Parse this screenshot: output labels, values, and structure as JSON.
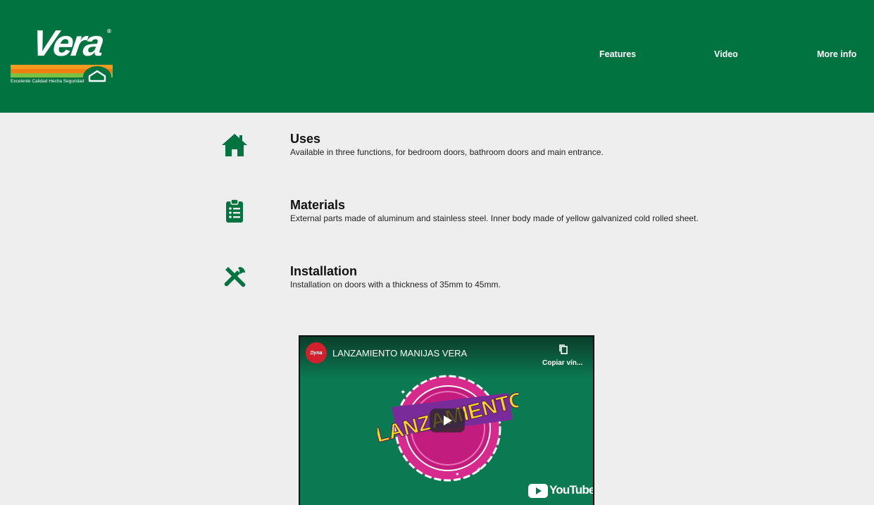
{
  "brand": {
    "name": "Vera",
    "registered": "®",
    "tagline": "Excelente Calidad Hecha Seguridad",
    "colors": {
      "primary": "#007340",
      "orange": "#f39a1e",
      "green_light": "#7cc242"
    }
  },
  "nav": {
    "items": [
      {
        "label": "Features"
      },
      {
        "label": "Video"
      },
      {
        "label": "More info"
      }
    ]
  },
  "features": [
    {
      "icon": "home-icon",
      "title": "Uses",
      "description": "Available in three functions, for bedroom doors, bathroom doors and main entrance."
    },
    {
      "icon": "clipboard-list-icon",
      "title": "Materials",
      "description": "External parts made of aluminum and stainless steel. Inner body made of yellow galvanized cold rolled sheet."
    },
    {
      "icon": "tools-icon",
      "title": "Installation",
      "description": "Installation on doors with a thickness of 35mm to 45mm."
    }
  ],
  "video": {
    "channel_avatar_text": "Dyna",
    "title": "LANZAMIENTO MANIJAS VERA",
    "copy_label": "Copiar vín...",
    "thumbnail_text": "LANZAMIENTO",
    "platform": "YouTube"
  }
}
